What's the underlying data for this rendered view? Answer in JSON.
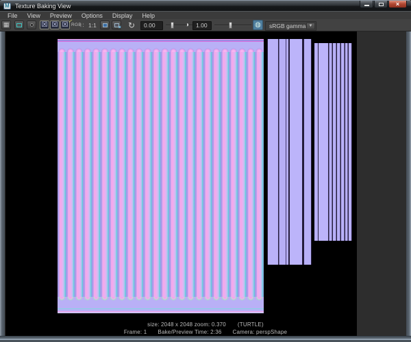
{
  "window": {
    "title": "Texture Baking View"
  },
  "menu": {
    "items": [
      "File",
      "View",
      "Preview",
      "Options",
      "Display",
      "Help"
    ]
  },
  "toolbar": {
    "rgb_label": "RGB",
    "ratio_label": "1:1",
    "exposure_value": "0.00",
    "contrast_value": "1.00",
    "colorspace_value": "sRGB gamma"
  },
  "status": {
    "size_zoom": "size: 2048 x 2048 zoom: 0.370",
    "renderer": "(TURTLE)",
    "frame": "Frame: 1",
    "bake_time": "Bake/Preview Time:  2:36",
    "camera": "Camera: perspShape"
  },
  "icons": {
    "maya-app-icon": "M",
    "close-icon": "×",
    "render-bake-icon": "▦",
    "checker-icon": "☒",
    "checker-edit-icon": "☒",
    "edit-pencil-badge": "∕",
    "pixel-grid-icon": "∷",
    "remove-x-badge": "×",
    "refresh-icon": "↻",
    "exposure-icon": "◑",
    "gamma-icon": "◍",
    "dropdown-arrow-icon": "▼"
  },
  "colors": {
    "frame": "#6d7884",
    "titlebar": "#2a2e32",
    "menubar": "#3b3b3b",
    "toolbar": "#424242",
    "viewport": "#2d2d2d",
    "canvas": "#000000",
    "lavender": "#b9b0f6",
    "pink": "#f3a9ec",
    "cyan": "#5fc6de",
    "magenta": "#d667da",
    "mint": "#a5dcc6",
    "stripe_dark": "#241c3c",
    "accent": "#4f7e9e",
    "close_red": "#c0503e",
    "text": "#d6d6d6",
    "status_text": "#bdbdbd"
  }
}
